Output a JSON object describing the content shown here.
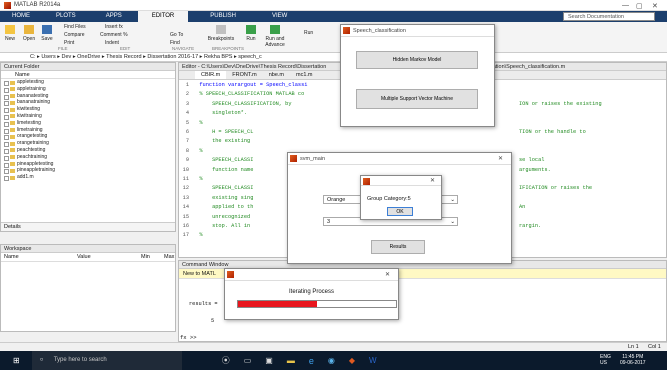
{
  "window": {
    "title": "MATLAB R2014a"
  },
  "tabs": [
    {
      "label": "HOME"
    },
    {
      "label": "PLOTS"
    },
    {
      "label": "APPS"
    },
    {
      "label": "EDITOR"
    },
    {
      "label": "PUBLISH"
    },
    {
      "label": "VIEW"
    }
  ],
  "search": {
    "placeholder": "Search Documentation"
  },
  "ribbon": {
    "new": "New",
    "open": "Open",
    "save": "Save",
    "find_files": "Find Files",
    "compare": "Compare",
    "print": "Print",
    "insert": "Insert",
    "comment": "Comment",
    "indent": "Indent",
    "goto": "Go To",
    "find": "Find",
    "breakpoints": "Breakpoints",
    "run": "Run",
    "run_advance": "Run and Advance",
    "advance": "Advance",
    "run_section": "Run",
    "file": "FILE",
    "edit": "EDIT",
    "navigate": "NAVIGATE",
    "bp": "BREAKPOINTS"
  },
  "address": {
    "path": [
      "C:",
      "Users",
      "Dev",
      "OneDrive",
      "Thesis Record",
      "Dissertation 2016-17",
      "Rekha BPS",
      "speech_c"
    ]
  },
  "current_folder": {
    "title": "Current Folder",
    "col_name": "Name",
    "items": [
      "appletesting",
      "appletraining",
      "bananatesting",
      "bananatraining",
      "kiwitesting",
      "kiwitraining",
      "limetesting",
      "limetraining",
      "orangetesting",
      "orangetraining",
      "peachtesting",
      "peachtraining",
      "pineappletesting",
      "pineappletraining",
      "add1.m"
    ],
    "details": "Details"
  },
  "workspace": {
    "title": "Workspace",
    "cols": [
      "Name",
      "Value",
      "Min",
      "Max"
    ]
  },
  "editor": {
    "title": "Editor - C:\\Users\\Dev\\OneDrive\\Thesis Record\\Dissertation",
    "title_right": "ification\\Speech_classification.m",
    "tabs": [
      "CBIR.m",
      "FRONT.m",
      "nbe.m",
      "mc1.m"
    ],
    "lines": [
      {
        "n": "1",
        "t": "  function varargout = Speech_classi"
      },
      {
        "n": "2",
        "t": "  % SPEECH_CLASSIFICATION MATLAB co"
      },
      {
        "n": "3",
        "t": "      SPEECH_CLASSIFICATION, by "
      },
      {
        "n": "4",
        "t": "      singleton*."
      },
      {
        "n": "5",
        "t": "  %"
      },
      {
        "n": "6",
        "t": "      H = SPEECH_CL"
      },
      {
        "n": "7",
        "t": "      the existing"
      },
      {
        "n": "8",
        "t": "  %"
      },
      {
        "n": "9",
        "t": "      SPEECH_CLASSI"
      },
      {
        "n": "10",
        "t": "      function name"
      },
      {
        "n": "11",
        "t": "  %"
      },
      {
        "n": "12",
        "t": "      SPEECH_CLASSI"
      },
      {
        "n": "13",
        "t": "      existing sing"
      },
      {
        "n": "14",
        "t": "      applied to th"
      },
      {
        "n": "15",
        "t": "      unrecognized"
      },
      {
        "n": "16",
        "t": "      stop. All in"
      },
      {
        "n": "17",
        "t": "  %"
      }
    ],
    "right_lines": {
      "3": "ION or raises the existing",
      "6": "TION or the handle to",
      "9": "se local",
      "10": "arguments.",
      "12": "IFICATION or raises the",
      "14": "An",
      "16": "rargin."
    }
  },
  "command_window": {
    "title": "Command Window",
    "new_to": "New to MATL",
    "results": "results =",
    "value": "5",
    "prompt": "fx >>"
  },
  "speech_dialog": {
    "title": "Speech_classification",
    "btn1": "Hidden Markov Model",
    "btn2": "Multiple Support Vector Machine"
  },
  "svm_dialog": {
    "title": "svm_main",
    "dropdown1": "Orange",
    "dropdown2": "3",
    "results_btn": "Results"
  },
  "msg_dialog": {
    "text": "Group Category:5",
    "ok": "OK"
  },
  "progress_dialog": {
    "label": "Iterating Process",
    "progress": 0.5,
    "bar_color": "#e8151d"
  },
  "statusbar": {
    "ln": "Ln 1",
    "col": "Col 1"
  },
  "taskbar": {
    "search": "Type here to search",
    "lang1": "ENG",
    "lang2": "US",
    "time": "11:45 PM",
    "date": "09-06-2017"
  }
}
